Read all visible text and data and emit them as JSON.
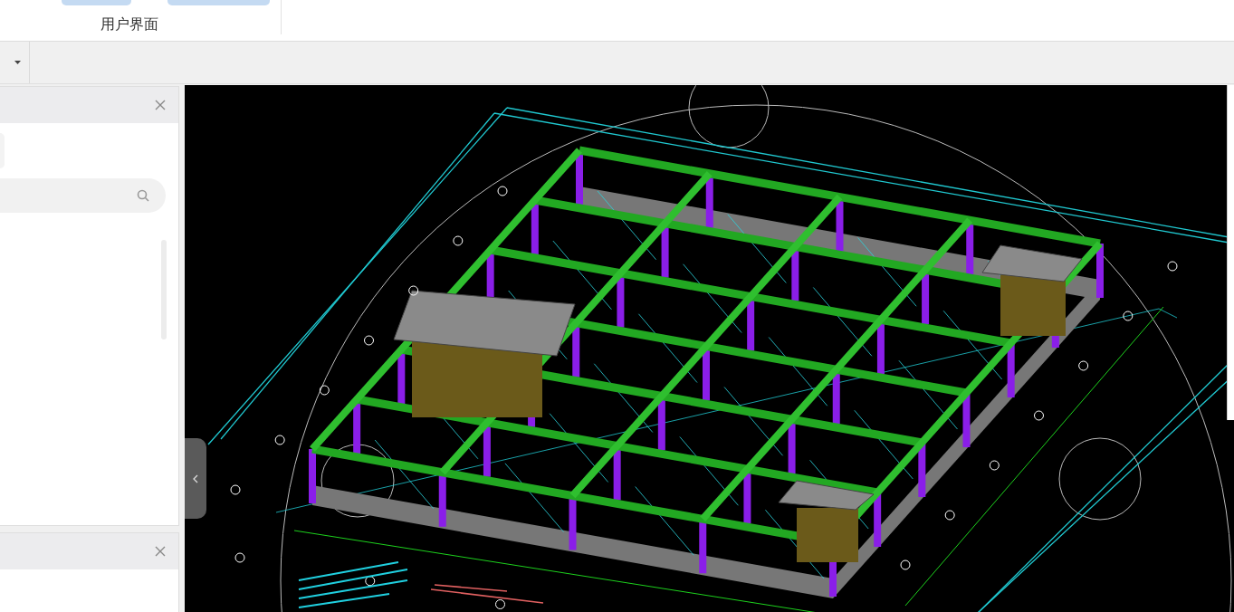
{
  "ribbon": {
    "groups": [
      {
        "label": "用户界面"
      }
    ]
  }
}
